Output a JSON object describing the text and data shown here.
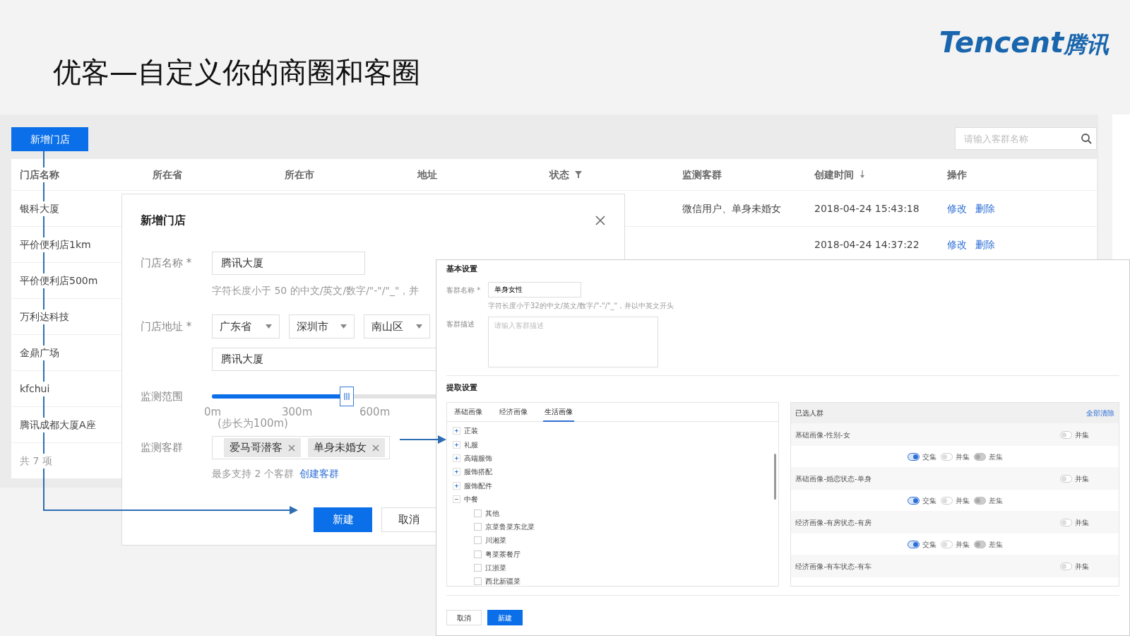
{
  "slide": {
    "title": "优客—自定义你的商圈和客圈",
    "logo": {
      "latin": "Tencent",
      "chinese": "腾讯"
    }
  },
  "store_list": {
    "add_button": "新增门店",
    "search": {
      "placeholder": "请输入客群名称"
    },
    "columns": [
      {
        "label": "门店名称",
        "kind": "plain"
      },
      {
        "label": "所在省",
        "kind": "plain"
      },
      {
        "label": "所在市",
        "kind": "plain"
      },
      {
        "label": "地址",
        "kind": "plain"
      },
      {
        "label": "状态",
        "kind": "filter"
      },
      {
        "label": "监测客群",
        "kind": "plain"
      },
      {
        "label": "创建时间",
        "kind": "sort"
      },
      {
        "label": "操作",
        "kind": "plain"
      }
    ],
    "rows": [
      {
        "name": "银科大厦",
        "audience": "微信用户、单身未婚女",
        "created": "2018-04-24 15:43:18",
        "actions": [
          "修改",
          "删除"
        ]
      },
      {
        "name": "平价便利店1km",
        "created": "2018-04-24 14:37:22",
        "actions": [
          "修改",
          "删除"
        ]
      },
      {
        "name": "平价便利店500m"
      },
      {
        "name": "万利达科技"
      },
      {
        "name": "金鼎广场"
      },
      {
        "name": "kfchui"
      },
      {
        "name": "腾讯成都大厦A座"
      }
    ],
    "footer": "共 7 项"
  },
  "store_dialog": {
    "title": "新增门店",
    "name_label": "门店名称 *",
    "name_value": "腾讯大厦",
    "name_hint": "字符长度小于 50 的中文/英文/数字/\"-\"/\"_\"，并",
    "address_label": "门店地址 *",
    "address_selects": [
      "广东省",
      "深圳市",
      "南山区"
    ],
    "address_value": "腾讯大厦",
    "range": {
      "label": "监测范围",
      "level": 0.6,
      "marks": [
        "0m",
        "300m",
        "600m"
      ],
      "step_note": "(步长为100m)"
    },
    "audience": {
      "label": "监测客群",
      "tags": [
        "爱马哥潜客",
        "单身未婚女"
      ],
      "hint": "最多支持 2 个客群",
      "link": "创建客群"
    },
    "buttons": {
      "confirm": "新建",
      "cancel": "取消"
    }
  },
  "audience_panel": {
    "basic_title": "基本设置",
    "name_label": "客群名称 *",
    "name_value": "单身女性",
    "name_hint": "字符长度小于32的中文/英文/数字/\"-\"/\"_\"，并以中英文开头",
    "desc_label": "客群描述",
    "desc_placeholder": "请输入客群描述",
    "extract_title": "提取设置",
    "tabs": [
      {
        "label": "基础画像",
        "selected": false
      },
      {
        "label": "经济画像",
        "selected": false
      },
      {
        "label": "生活画像",
        "selected": true
      }
    ],
    "tree": [
      {
        "label": "正装",
        "expanded": false
      },
      {
        "label": "礼服",
        "expanded": false
      },
      {
        "label": "高端服饰",
        "expanded": false
      },
      {
        "label": "服饰搭配",
        "expanded": false
      },
      {
        "label": "服饰配件",
        "expanded": false
      },
      {
        "label": "中餐",
        "expanded": true,
        "children": [
          {
            "label": "其他",
            "checked": false
          },
          {
            "label": "京菜鲁菜东北菜",
            "checked": false
          },
          {
            "label": "川湘菜",
            "checked": false
          },
          {
            "label": "粤菜茶餐厅",
            "checked": false
          },
          {
            "label": "江浙菜",
            "checked": false
          },
          {
            "label": "西北新疆菜",
            "checked": false
          }
        ]
      }
    ],
    "selected_box": {
      "title": "已选人群",
      "clear_link": "全部清除",
      "items": [
        {
          "label": "基础画像-性别-女",
          "union": {
            "label": "并集",
            "on": false
          },
          "operators": [
            {
              "label": "交集",
              "selected": true,
              "disabled": false
            },
            {
              "label": "并集",
              "selected": false,
              "disabled": false
            },
            {
              "label": "差集",
              "selected": false,
              "disabled": true
            }
          ]
        },
        {
          "label": "基础画像-婚恋状态-单身",
          "union": {
            "label": "并集",
            "on": false
          },
          "operators": [
            {
              "label": "交集",
              "selected": true,
              "disabled": false
            },
            {
              "label": "并集",
              "selected": false,
              "disabled": false
            },
            {
              "label": "差集",
              "selected": false,
              "disabled": true
            }
          ]
        },
        {
          "label": "经济画像-有房状态-有房",
          "union": {
            "label": "并集",
            "on": false
          },
          "operators": [
            {
              "label": "交集",
              "selected": true,
              "disabled": false
            },
            {
              "label": "并集",
              "selected": false,
              "disabled": false
            },
            {
              "label": "差集",
              "selected": false,
              "disabled": true
            }
          ]
        },
        {
          "label": "经济画像-有车状态-有车",
          "union": {
            "label": "并集",
            "on": false
          }
        }
      ]
    },
    "buttons": {
      "cancel": "取消",
      "confirm": "新建"
    }
  }
}
